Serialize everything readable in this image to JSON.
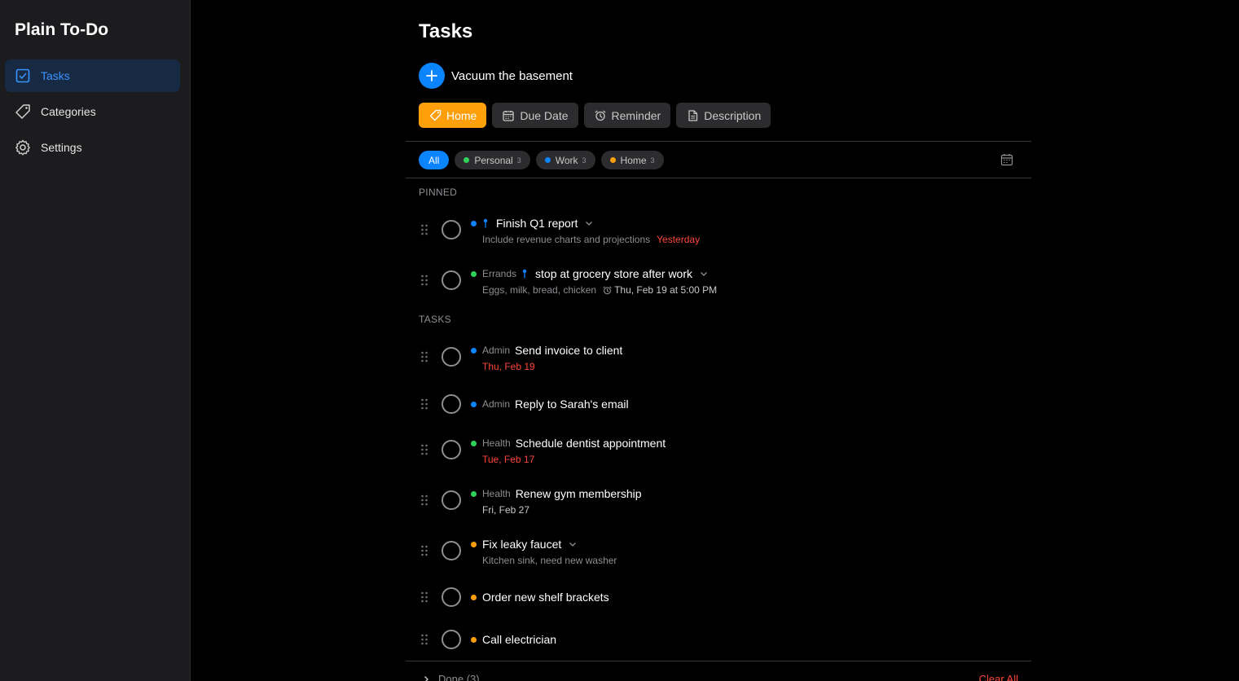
{
  "app": {
    "title": "Plain To-Do"
  },
  "sidebar": {
    "items": [
      {
        "label": "Tasks",
        "icon": "checkbox-icon",
        "active": true
      },
      {
        "label": "Categories",
        "icon": "tag-icon"
      },
      {
        "label": "Settings",
        "icon": "gear-icon"
      }
    ]
  },
  "main": {
    "title": "Tasks",
    "new_task_value": "Vacuum the basement",
    "options": {
      "category": "Home",
      "due_date": "Due Date",
      "reminder": "Reminder",
      "description": "Description"
    },
    "filters": [
      {
        "label": "All",
        "active": true
      },
      {
        "label": "Personal",
        "count": "3",
        "color": "#30d158"
      },
      {
        "label": "Work",
        "count": "3",
        "color": "#0a84ff"
      },
      {
        "label": "Home",
        "count": "3",
        "color": "#ff9f0a"
      }
    ],
    "pinned_label": "PINNED",
    "tasks_label": "TASKS",
    "pinned": [
      {
        "title": "Finish Q1 report",
        "description": "Include revenue charts and projections",
        "due": "Yesterday",
        "color": "#0a84ff"
      },
      {
        "category": "Errands",
        "title": "stop at grocery store after work",
        "description": "Eggs, milk, bread, chicken",
        "reminder": "Thu, Feb 19 at 5:00 PM",
        "color": "#30d158"
      }
    ],
    "tasks": [
      {
        "category": "Admin",
        "title": "Send invoice to client",
        "due": "Thu, Feb 19",
        "color": "#0a84ff"
      },
      {
        "category": "Admin",
        "title": "Reply to Sarah's email",
        "color": "#0a84ff"
      },
      {
        "category": "Health",
        "title": "Schedule dentist appointment",
        "due": "Tue, Feb 17",
        "color": "#30d158"
      },
      {
        "category": "Health",
        "title": "Renew gym membership",
        "due": "Fri, Feb 27",
        "color": "#30d158"
      },
      {
        "title": "Fix leaky faucet",
        "description": "Kitchen sink, need new washer",
        "color": "#ff9f0a"
      },
      {
        "title": "Order new shelf brackets",
        "color": "#ff9f0a"
      },
      {
        "title": "Call electrician",
        "color": "#ff9f0a"
      }
    ],
    "done_label": "Done (3)",
    "clear_all": "Clear All"
  }
}
